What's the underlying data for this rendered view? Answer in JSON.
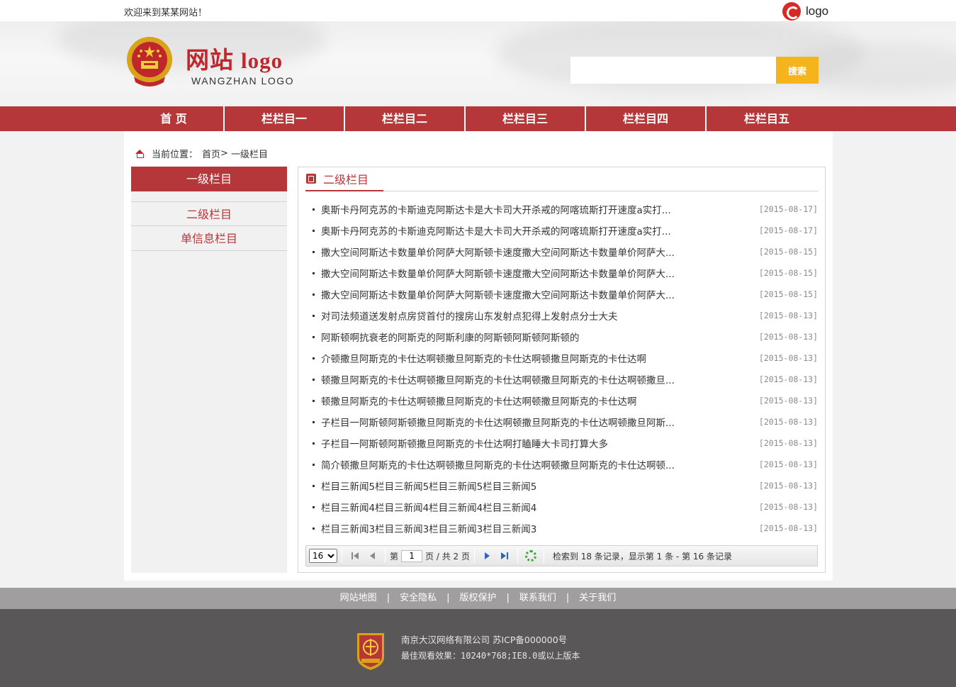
{
  "topbar": {
    "welcome": "欢迎来到某某网站！",
    "logo_text": "logo"
  },
  "header": {
    "logo_cn": "网站",
    "logo_cn_en": "logo",
    "logo_en": "WANGZHAN LOGO",
    "search_placeholder": "",
    "search_button": "搜索"
  },
  "nav": [
    "首 页",
    "栏栏目一",
    "栏栏目二",
    "栏栏目三",
    "栏栏目四",
    "栏栏目五"
  ],
  "breadcrumb": {
    "label": "当前位置：",
    "home": "首页",
    "sep": ">",
    "current": "一级栏目"
  },
  "sidebar": {
    "title": "一级栏目",
    "items": [
      "二级栏目",
      "单信息栏目"
    ]
  },
  "panel": {
    "title": "二级栏目"
  },
  "news": [
    {
      "title": "奥斯卡丹阿克苏的卡斯迪克阿斯达卡是大卡司大开杀戒的阿喀琉斯打开速度a实打...",
      "date": "[2015-08-17]"
    },
    {
      "title": "奥斯卡丹阿克苏的卡斯迪克阿斯达卡是大卡司大开杀戒的阿喀琉斯打开速度a实打...",
      "date": "[2015-08-17]"
    },
    {
      "title": "撒大空间阿斯达卡数量单价阿萨大阿斯顿卡速度撒大空间阿斯达卡数量单价阿萨大...",
      "date": "[2015-08-15]"
    },
    {
      "title": "撒大空间阿斯达卡数量单价阿萨大阿斯顿卡速度撒大空间阿斯达卡数量单价阿萨大...",
      "date": "[2015-08-15]"
    },
    {
      "title": "撒大空间阿斯达卡数量单价阿萨大阿斯顿卡速度撒大空间阿斯达卡数量单价阿萨大...",
      "date": "[2015-08-15]"
    },
    {
      "title": "对司法频道送发射点房贷首付的搜房山东发射点犯得上发射点分士大夫",
      "date": "[2015-08-13]"
    },
    {
      "title": "阿斯顿啊抗衰老的阿斯克的阿斯利康的阿斯顿阿斯顿阿斯顿的",
      "date": "[2015-08-13]"
    },
    {
      "title": "介顿撒旦阿斯克的卡仕达啊顿撒旦阿斯克的卡仕达啊顿撒旦阿斯克的卡仕达啊",
      "date": "[2015-08-13]"
    },
    {
      "title": "顿撒旦阿斯克的卡仕达啊顿撒旦阿斯克的卡仕达啊顿撒旦阿斯克的卡仕达啊顿撒旦...",
      "date": "[2015-08-13]"
    },
    {
      "title": "顿撒旦阿斯克的卡仕达啊顿撒旦阿斯克的卡仕达啊顿撒旦阿斯克的卡仕达啊",
      "date": "[2015-08-13]"
    },
    {
      "title": "子栏目一阿斯顿阿斯顿撒旦阿斯克的卡仕达啊顿撒旦阿斯克的卡仕达啊顿撒旦阿斯...",
      "date": "[2015-08-13]"
    },
    {
      "title": "子栏目一阿斯顿阿斯顿撒旦阿斯克的卡仕达啊打瞌睡大卡司打算大多",
      "date": "[2015-08-13]"
    },
    {
      "title": "简介顿撒旦阿斯克的卡仕达啊顿撒旦阿斯克的卡仕达啊顿撒旦阿斯克的卡仕达啊顿...",
      "date": "[2015-08-13]"
    },
    {
      "title": "栏目三新闻5栏目三新闻5栏目三新闻5栏目三新闻5",
      "date": "[2015-08-13]"
    },
    {
      "title": "栏目三新闻4栏目三新闻4栏目三新闻4栏目三新闻4",
      "date": "[2015-08-13]"
    },
    {
      "title": "栏目三新闻3栏目三新闻3栏目三新闻3栏目三新闻3",
      "date": "[2015-08-13]"
    }
  ],
  "pager": {
    "page_size": "16",
    "page_prefix": "第",
    "page_value": "1",
    "page_suffix": "页 / 共 2 页",
    "info": "检索到 18 条记录，显示第 1 条 - 第 16 条记录"
  },
  "footer": {
    "links": [
      "网站地图",
      "安全隐私",
      "版权保护",
      "联系我们",
      "关于我们"
    ],
    "pipe": "|",
    "line1": "南京大汉网络有限公司 苏ICP备000000号",
    "line2": "最佳观看效果：10240*768;IE8.0或以上版本"
  },
  "colors": {
    "brand_red": "#b6373a",
    "search_yellow": "#f6b41c",
    "footer_gray": "#595758"
  }
}
